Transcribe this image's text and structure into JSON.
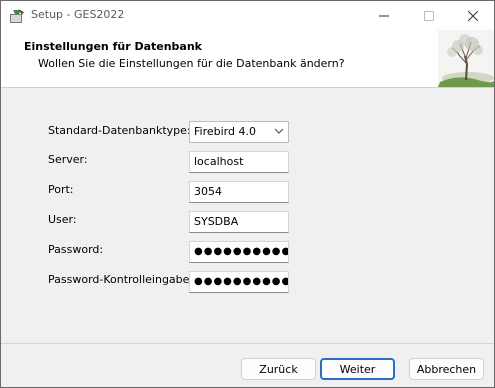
{
  "window": {
    "title": "Setup - GES2022",
    "controls": [
      "minimize-icon",
      "maximize-icon",
      "close-icon"
    ]
  },
  "header": {
    "title": "Einstellungen für Datenbank",
    "subtitle": "Wollen Sie die Einstellungen für die Datenbank ändern?"
  },
  "form": {
    "db_type": {
      "label": "Standard-Datenbanktype:",
      "value": "Firebird 4.0"
    },
    "server": {
      "label": "Server:",
      "value": "localhost"
    },
    "port": {
      "label": "Port:",
      "value": "3054"
    },
    "user": {
      "label": "User:",
      "value": "SYSDBA"
    },
    "password": {
      "label": "Password:",
      "value": "●●●●●●●●●●"
    },
    "password_confirm": {
      "label": "Password-Kontrolleingabe:",
      "value": "●●●●●●●●●●"
    }
  },
  "buttons": {
    "back": "Zurück",
    "next": "Weiter",
    "cancel": "Abbrechen"
  },
  "colors": {
    "accent": "#2a6fc4",
    "window_bg": "#f0f0f0",
    "header_bg": "#ffffff"
  }
}
